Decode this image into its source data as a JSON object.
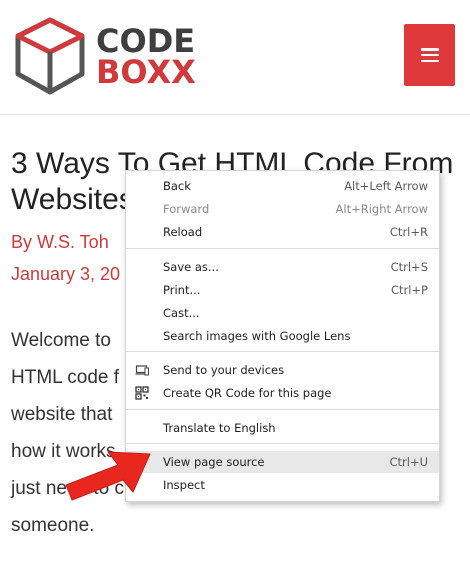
{
  "logo": {
    "line1": "CODE",
    "line2": "BOXX",
    "colors": {
      "dark": "#3f3f3f",
      "red": "#d1393a"
    }
  },
  "menu_icon": "hamburger-icon",
  "article": {
    "title_line1": "3 Ways To Get HTML Code From",
    "title_line2": "Websites",
    "author": "By W.S. Toh",
    "date": "January 3, 20",
    "body_lines": [
      "Welcome to",
      "HTML code f",
      "website that",
      "how it works",
      "just need to c",
      "someone."
    ]
  },
  "context_menu": {
    "back": {
      "label": "Back",
      "shortcut": "Alt+Left Arrow"
    },
    "forward": {
      "label": "Forward",
      "shortcut": "Alt+Right Arrow"
    },
    "reload": {
      "label": "Reload",
      "shortcut": "Ctrl+R"
    },
    "save_as": {
      "label": "Save as...",
      "shortcut": "Ctrl+S"
    },
    "print": {
      "label": "Print...",
      "shortcut": "Ctrl+P"
    },
    "cast": {
      "label": "Cast..."
    },
    "lens": {
      "label": "Search images with Google Lens"
    },
    "send_devices": {
      "label": "Send to your devices"
    },
    "qr": {
      "label": "Create QR Code for this page"
    },
    "translate": {
      "label": "Translate to English"
    },
    "view_source": {
      "label": "View page source",
      "shortcut": "Ctrl+U"
    },
    "inspect": {
      "label": "Inspect"
    }
  },
  "colors": {
    "accent": "#e0393b",
    "highlight": "#e8e8e8",
    "arrow": "#e8281f"
  }
}
